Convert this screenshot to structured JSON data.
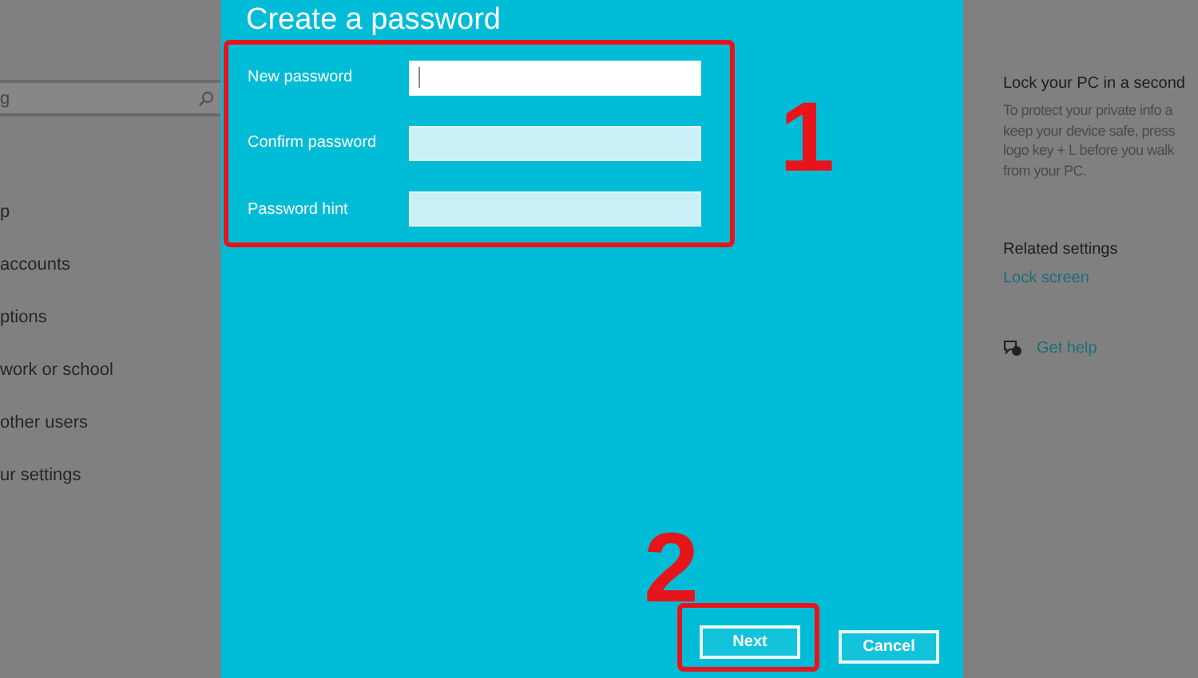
{
  "left_panel": {
    "search": {
      "value": "g"
    },
    "items": [
      {
        "label": "p"
      },
      {
        "label": "accounts"
      },
      {
        "label": "ptions"
      },
      {
        "label": "work or school"
      },
      {
        "label": "other users"
      },
      {
        "label": "ur settings"
      }
    ]
  },
  "dialog": {
    "title": "Create a password",
    "fields": [
      {
        "label": "New password",
        "focused": true
      },
      {
        "label": "Confirm password",
        "focused": false
      },
      {
        "label": "Password hint",
        "focused": false
      }
    ],
    "buttons": [
      {
        "label": "Next",
        "highlighted": true
      },
      {
        "label": "Cancel",
        "highlighted": false
      }
    ],
    "annotations": [
      {
        "label": "1"
      },
      {
        "label": "2"
      }
    ]
  },
  "right_panel": {
    "heading": "Lock your PC in a second",
    "description_lines": [
      "To protect your private info a",
      "keep your device safe, press",
      "logo key + L before you walk",
      "from your PC."
    ],
    "related_heading": "Related settings",
    "related_link": "Lock screen",
    "help_link": "Get help"
  }
}
